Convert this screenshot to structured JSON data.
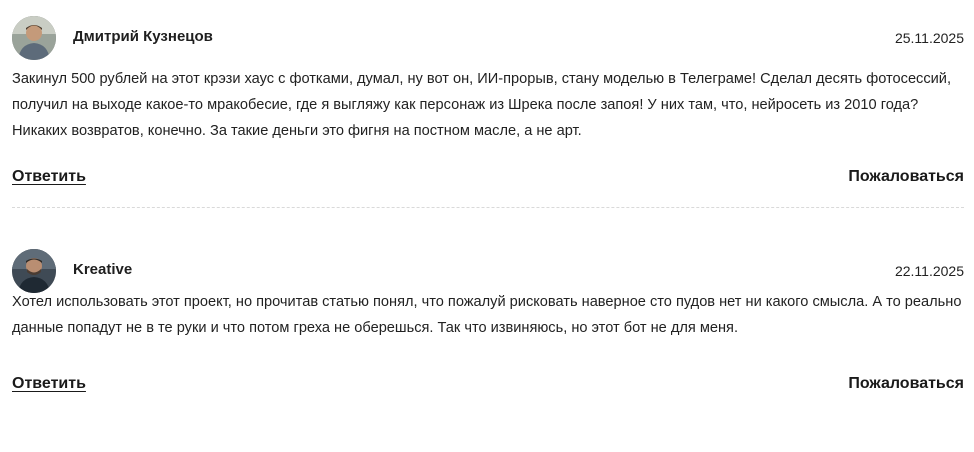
{
  "comments": [
    {
      "author": "Дмитрий Кузнецов",
      "date": "25.11.2025",
      "text": "Закинул 500 рублей на этот крэзи хаус с фотками, думал, ну вот он, ИИ-прорыв, стану моделью в Телеграме! Сделал десять фотосессий, получил на выходе какое-то мракобесие, где я выгляжу как персонаж из Шрека после запоя! У них там, что, нейросеть из 2010 года? Никаких возвратов, конечно. За такие деньги это фигня на постном масле, а не арт.",
      "reply_label": "Ответить",
      "report_label": "Пожаловаться",
      "avatar_icon": "user-photo-avatar"
    },
    {
      "author": "Kreative",
      "date": "22.11.2025",
      "text": "Хотел использовать этот проект, но прочитав статью понял, что пожалуй рисковать наверное сто пудов нет ни какого смысла. А то реально данные попадут не в те руки и что потом греха не оберешься. Так что извиняюсь, но этот бот не для меня.",
      "reply_label": "Ответить",
      "report_label": "Пожаловаться",
      "avatar_icon": "user-photo-avatar"
    }
  ],
  "colors": {
    "text": "#1a1a1a",
    "divider": "#d9d9d9",
    "background": "#ffffff"
  }
}
